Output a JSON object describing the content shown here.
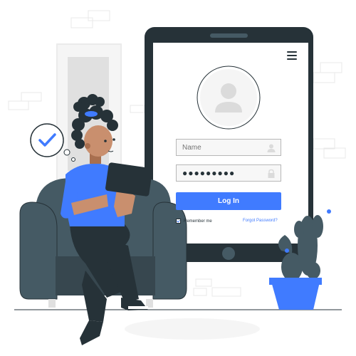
{
  "login_form": {
    "name_placeholder": "Name",
    "password_value": "●●●●●●●●●",
    "login_label": "Log In",
    "remember_label": "Remember me",
    "remember_checked": true,
    "forgot_label": "Forgot Password?"
  },
  "icons": {
    "menu": "hamburger-menu-icon",
    "avatar": "user-avatar-icon",
    "name_field": "user-icon",
    "password_field": "lock-icon",
    "verified": "checkmark-icon"
  },
  "colors": {
    "accent": "#407BFF",
    "dark": "#263238",
    "grey": "#455A64",
    "light": "#F5F5F5"
  }
}
